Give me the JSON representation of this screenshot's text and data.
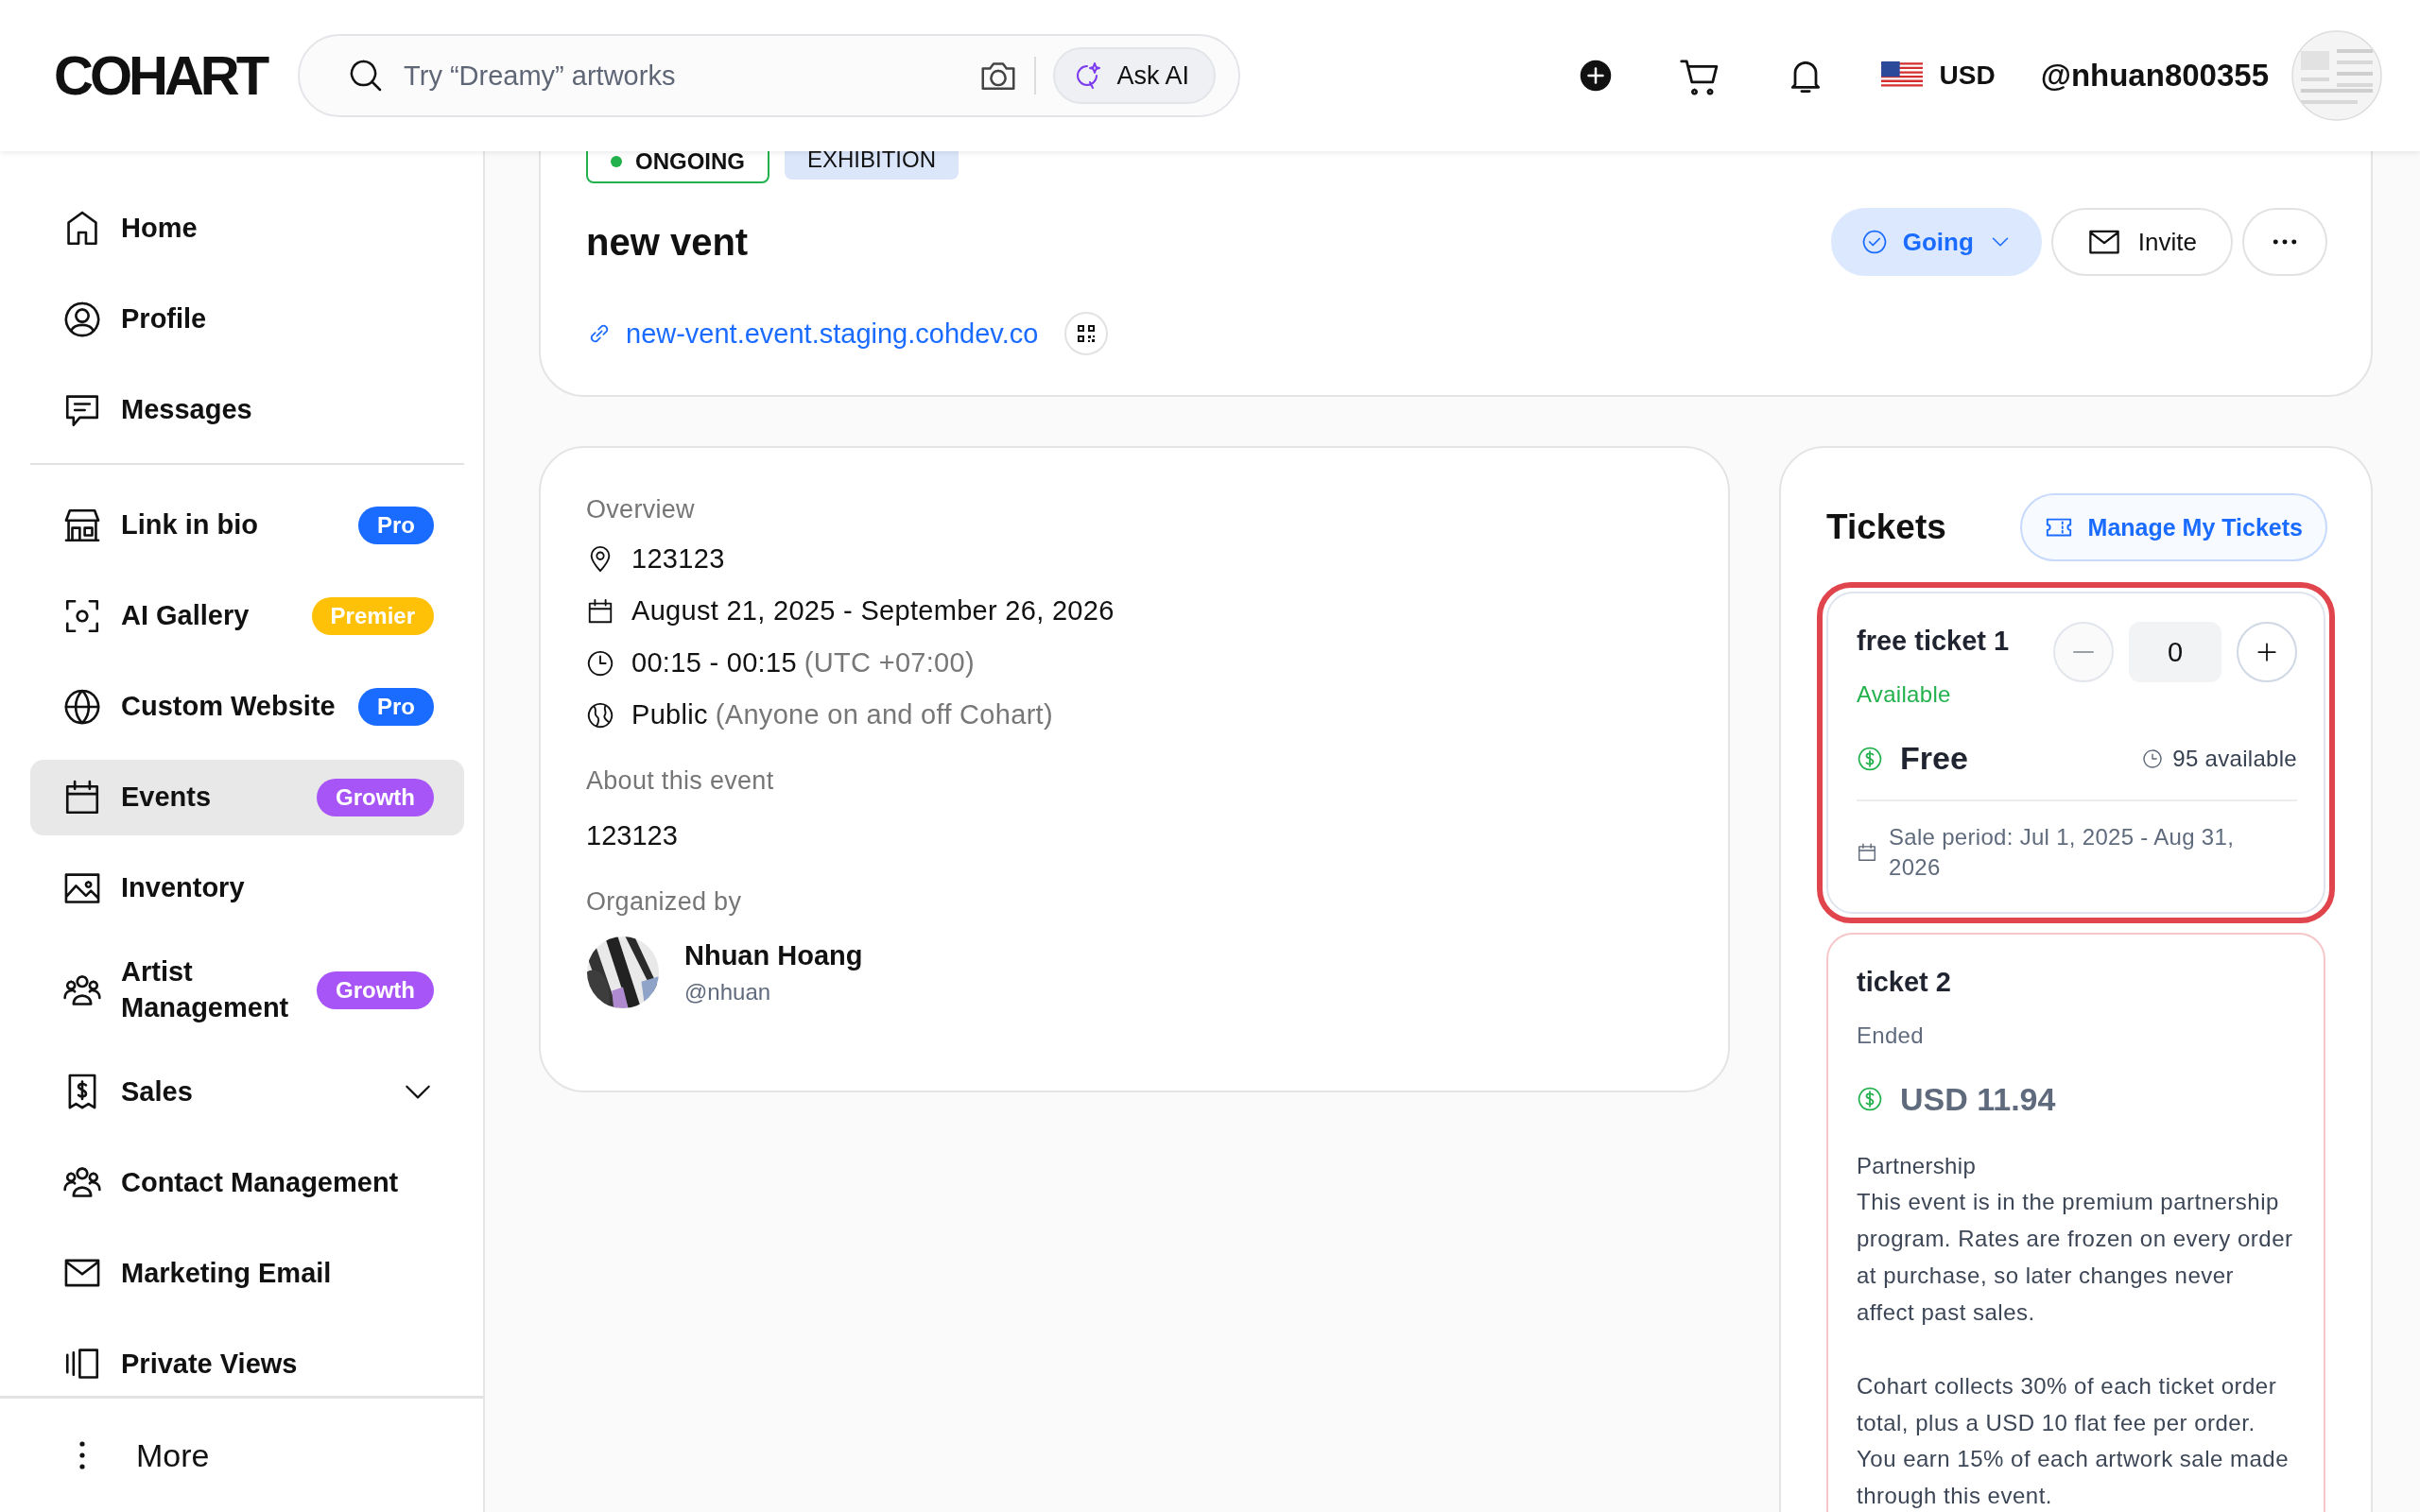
{
  "header": {
    "logo": "COHART",
    "search": {
      "placeholder": "Try “Dreamy” artworks"
    },
    "ask_ai": "Ask AI",
    "currency": "USD",
    "username": "@nhuan800355"
  },
  "sidebar": {
    "groups": [
      [
        {
          "label": "Home",
          "selected": false
        },
        {
          "label": "Profile",
          "selected": false
        },
        {
          "label": "Messages",
          "selected": false
        }
      ],
      [
        {
          "label": "Link in bio",
          "selected": false,
          "badge": {
            "text": "Pro",
            "color": "#1a6bff"
          }
        },
        {
          "label": "AI Gallery",
          "selected": false,
          "badge": {
            "text": "Premier",
            "color": "#ffc107"
          }
        },
        {
          "label": "Custom Website",
          "selected": false,
          "badge": {
            "text": "Pro",
            "color": "#1a6bff"
          }
        },
        {
          "label": "Events",
          "selected": true,
          "badge": {
            "text": "Growth",
            "color": "#a855f7"
          }
        },
        {
          "label": "Inventory",
          "selected": false
        },
        {
          "label": "Artist Management",
          "selected": false,
          "badge": {
            "text": "Growth",
            "color": "#a855f7"
          }
        },
        {
          "label": "Sales",
          "selected": false,
          "expanded": false
        },
        {
          "label": "Contact Management",
          "selected": false
        },
        {
          "label": "Marketing Email",
          "selected": false
        },
        {
          "label": "Private Views",
          "selected": false
        }
      ]
    ],
    "more": "More"
  },
  "event": {
    "tags": [
      {
        "text": "ONGOING",
        "kind": "status"
      },
      {
        "text": "EXHIBITION",
        "kind": "category"
      }
    ],
    "title": "new vent",
    "link": "new-vent.event.staging.cohdev.co",
    "rsvp": {
      "label": "Going",
      "selected": true
    },
    "invite": "Invite"
  },
  "overview": {
    "label": "Overview",
    "details": [
      {
        "text": "123123"
      },
      {
        "text": "August 21, 2025 - September 26, 2026"
      },
      {
        "text": "00:15 - 00:15",
        "note": "(UTC +07:00)"
      },
      {
        "text": "Public",
        "note": "(Anyone on and off Cohart)"
      }
    ],
    "about_label": "About this event",
    "about": "123123",
    "organized_label": "Organized by",
    "organizer": {
      "name": "Nhuan Hoang",
      "handle": "@nhuan"
    }
  },
  "tickets": {
    "title": "Tickets",
    "manage": "Manage My Tickets",
    "items": [
      {
        "name": "free ticket 1",
        "status": "Available",
        "kind": "available",
        "highlighted": true,
        "quantity": "0",
        "price": "Free",
        "remaining": "95 available",
        "sale_period": "Sale period: Jul 1, 2025 - Aug 31, 2026"
      },
      {
        "name": "ticket 2",
        "status": "Ended",
        "kind": "ended",
        "highlighted": false,
        "price": "USD 11.94",
        "plan": "Partnership",
        "paragraphs": [
          "This event is in the premium partnership program. Rates are frozen on every order at purchase, so later changes never affect past sales.",
          "Cohart collects 30% of each ticket order total, plus a USD 10 flat fee per order. You earn 15% of each artwork sale made through this event."
        ]
      }
    ]
  }
}
